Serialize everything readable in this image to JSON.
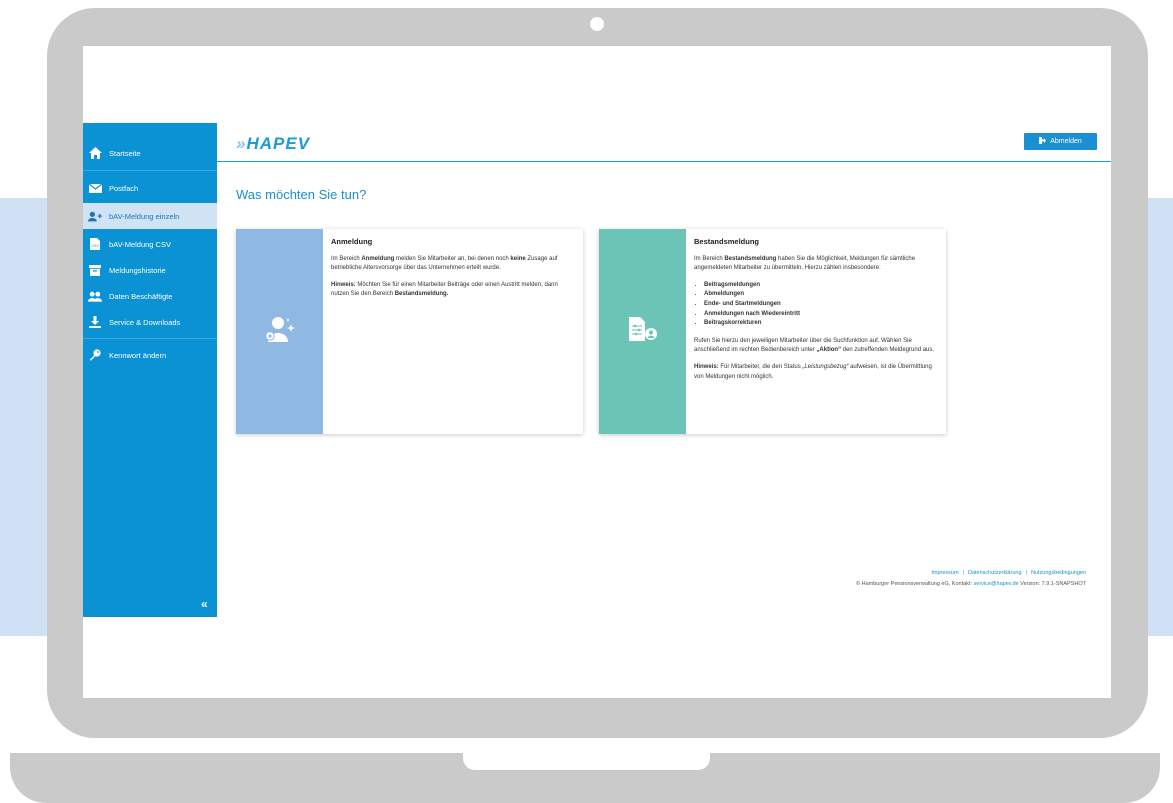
{
  "sidebar": {
    "items": [
      {
        "label": "Startseite",
        "icon": "home-icon"
      },
      {
        "label": "Postfach",
        "icon": "mail-icon"
      },
      {
        "label": "bAV-Meldung einzeln",
        "icon": "add-user-icon"
      },
      {
        "label": "bAV-Meldung CSV",
        "icon": "csv-file-icon"
      },
      {
        "label": "Meldungshistorie",
        "icon": "archive-icon"
      },
      {
        "label": "Daten Beschäftigte",
        "icon": "users-icon"
      },
      {
        "label": "Service & Downloads",
        "icon": "download-icon"
      },
      {
        "label": "Kennwort ändern",
        "icon": "key-icon"
      }
    ],
    "collapse_label": "«"
  },
  "header": {
    "logo": "HAPEV",
    "logout_label": "Abmelden"
  },
  "main": {
    "title": "Was möchten Sie tun?",
    "cards": [
      {
        "title": "Anmeldung",
        "color": "#8fb9e3",
        "p1_a": "Im Bereich ",
        "p1_b": "Anmeldung",
        "p1_c": " melden Sie Mitarbeiter an, bei denen noch ",
        "p1_d": "keine",
        "p1_e": " Zusage auf betriebliche Altersvorsorge über das Unternehmen erteilt wurde.",
        "p2_a": "Hinweis:",
        "p2_b": " Möchten Sie für einen Mitarbeiter Beiträge oder einen Austritt melden, dann nutzen Sie den Bereich ",
        "p2_c": "Bestandsmeldung."
      },
      {
        "title": "Bestandsmeldung",
        "color": "#6cc4b7",
        "p1_a": "Im Bereich ",
        "p1_b": "Bestandsmeldung",
        "p1_c": " haben Sie die Möglichkeit, Meldungen für sämtliche angemeldeten Mitarbeiter zu übermitteln. Hierzu zählen insbesondere:",
        "list": [
          "Beitragsmeldungen",
          "Abmeldungen",
          "Ende- und Startmeldungen",
          "Anmeldungen nach Wiedereintritt",
          "Beitragskorrekturen"
        ],
        "p2_a": "Rufen Sie hierzu den jeweiligen Mitarbeiter über die Suchfunktion auf. Wählen Sie anschließend im rechten Bedienbereich unter ",
        "p2_b": "„Aktion“",
        "p2_c": " den zutreffenden Meldegrund aus.",
        "p3_a": "Hinweis:",
        "p3_b": " Für Mitarbeiter, die den Status ",
        "p3_c": "„Leistungsbezug“",
        "p3_d": " aufweisen, ist die Übermittlung von Meldungen nicht möglich."
      }
    ]
  },
  "footer": {
    "links": [
      "Impressum",
      "Datenschutzerklärung",
      "Nutzungsbedingungen"
    ],
    "copyright_a": "© Hamburger Pensionsverwaltung eG, Kontakt: ",
    "email": "service@hapev.de",
    "copyright_b": " Version: 7.9.1-SNAPSHOT"
  }
}
